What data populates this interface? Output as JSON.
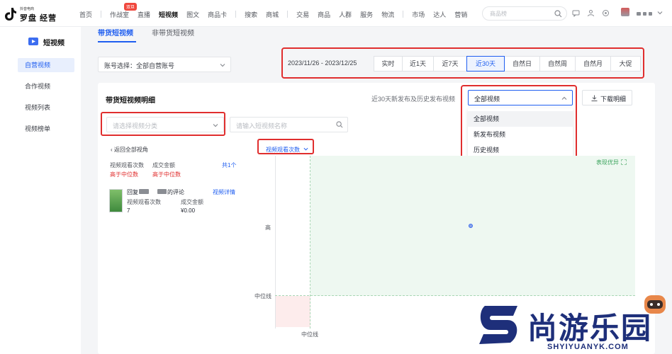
{
  "brand": {
    "small": "抖音电商",
    "big": "罗盘 经营"
  },
  "nav": {
    "items": [
      "首页",
      "作战室",
      "直播",
      "短视频",
      "图文",
      "商品卡",
      "搜索",
      "商城",
      "交易",
      "商品",
      "人群",
      "服务",
      "物流",
      "市场",
      "达人",
      "营销"
    ],
    "active": "短视频",
    "badge": "双旦",
    "search_placeholder": "商品榜"
  },
  "sidebar": {
    "title": "短视频",
    "items": [
      {
        "label": "自营视频",
        "active": true
      },
      {
        "label": "合作视频",
        "active": false
      },
      {
        "label": "视频列表",
        "active": false
      },
      {
        "label": "视频榜单",
        "active": false
      }
    ]
  },
  "tabs": [
    "带货短视频",
    "非带货短视频"
  ],
  "account_select": {
    "label": "账号选择：全部自营账号"
  },
  "date": {
    "range": "2023/11/26 - 2023/12/25",
    "options": [
      "实时",
      "近1天",
      "近7天",
      "近30天",
      "自然日",
      "自然周",
      "自然月",
      "大促"
    ],
    "active": "近30天"
  },
  "panel": {
    "title": "带货短视频明细",
    "note": "近30天新发布及历史发布视频",
    "select_value": "全部视频",
    "dropdown_options": [
      "全部视频",
      "新发布视频",
      "历史视频"
    ],
    "download": "下载明细",
    "category_placeholder": "请选择视频分类",
    "name_placeholder": "请输入短视频名称",
    "back": "返回全部视角",
    "metric": "视频观看次数",
    "summary": {
      "metric1": "视频观看次数",
      "metric2": "成交金额",
      "tag1": "高于中位数",
      "tag2": "高于中位数",
      "total": "共1个"
    },
    "video": {
      "title_prefix": "回复",
      "title_suffix": "的评论",
      "detail": "视频详情",
      "stat1_label": "视频观看次数",
      "stat1_value": "7",
      "stat2_label": "成交金额",
      "stat2_value": "¥0.00"
    }
  },
  "chart_data": {
    "type": "scatter",
    "quadrant_label": "表现优异",
    "y_high_label": "高",
    "median_label_y": "中位线",
    "median_label_x": "中位线",
    "points": [
      {
        "views": 7,
        "sales": 0
      }
    ]
  },
  "watermark": {
    "cn": "尚游乐园",
    "url": "SHYIYUANYK.COM"
  }
}
